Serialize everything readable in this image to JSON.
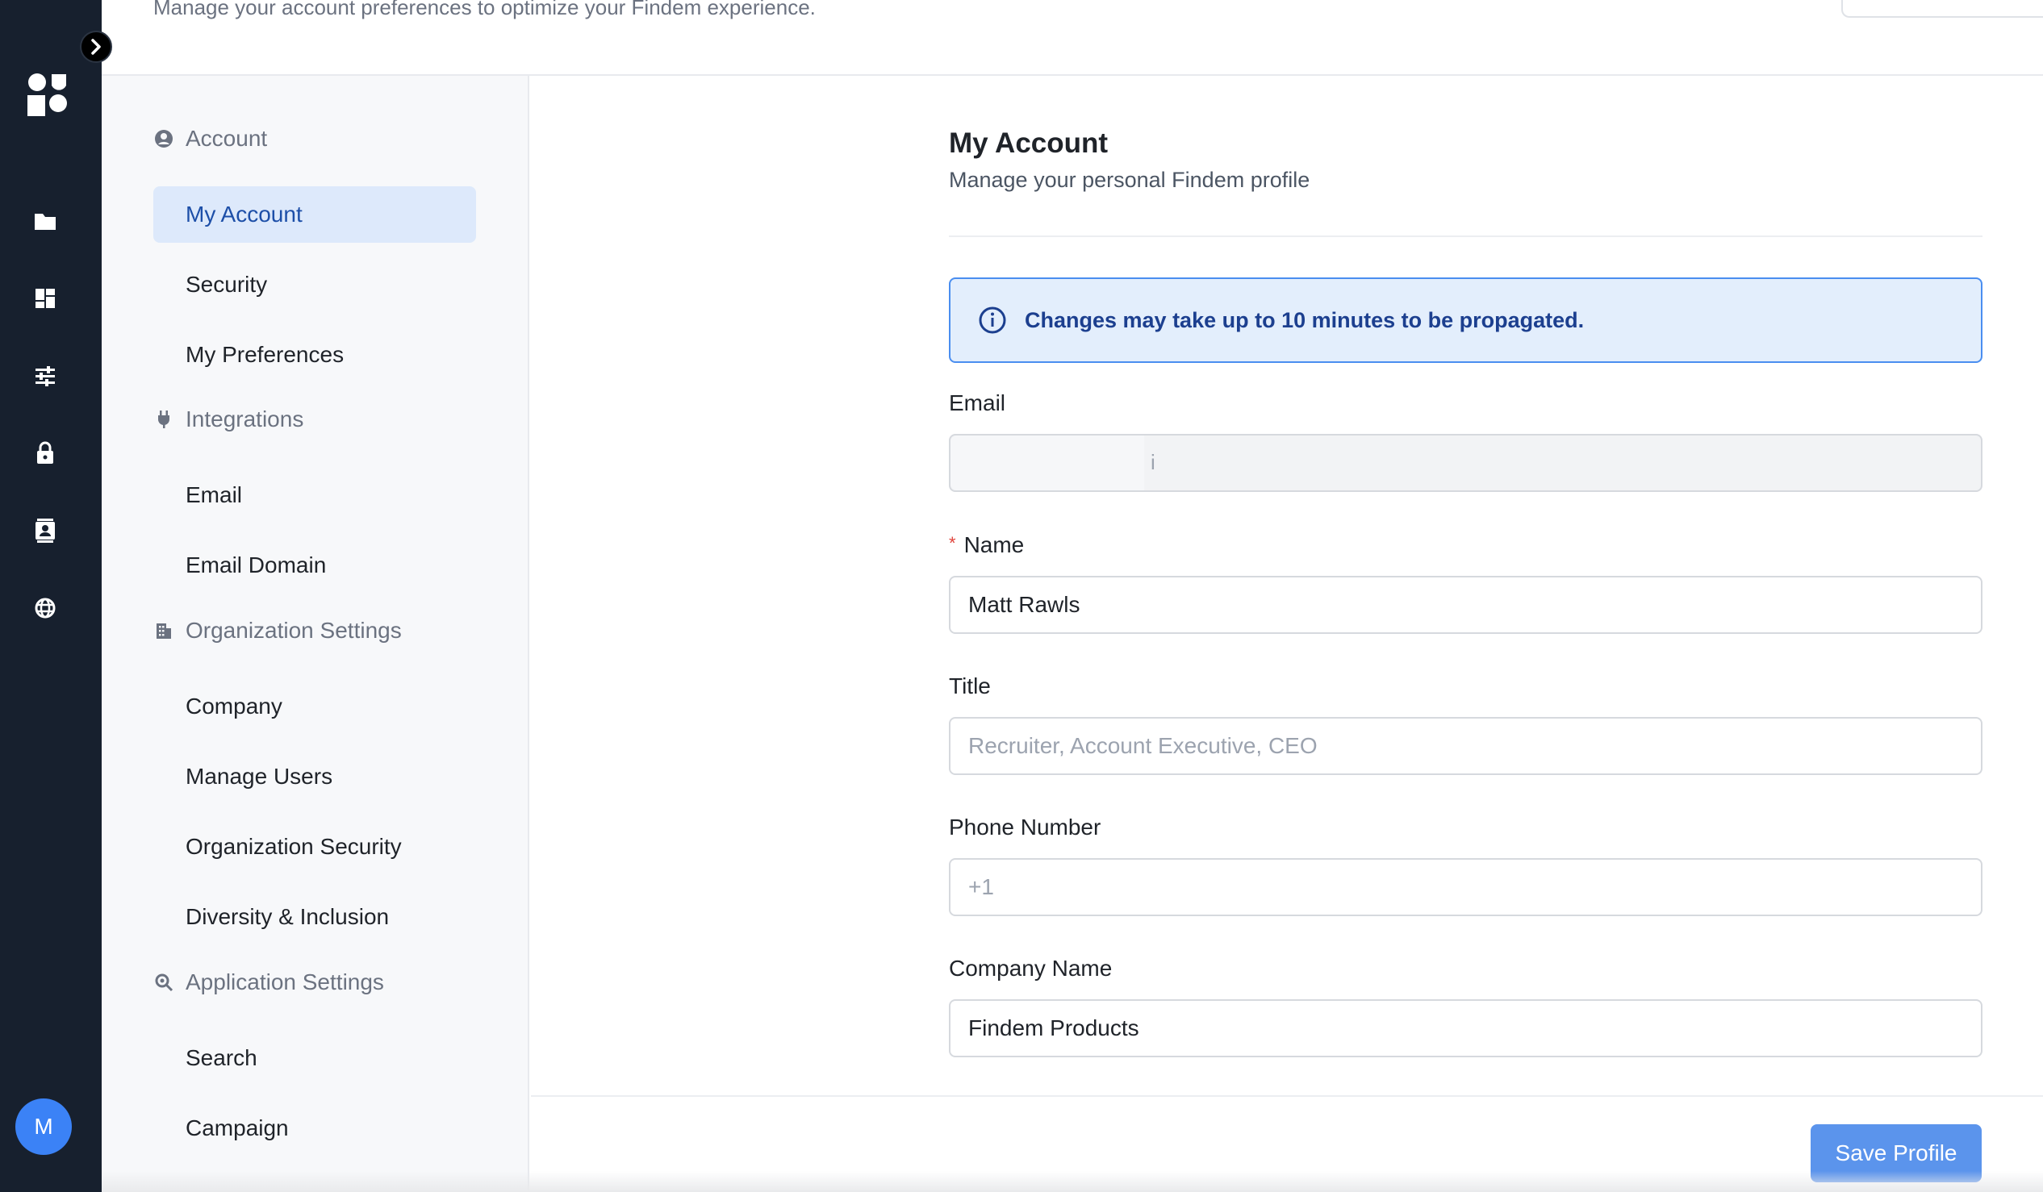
{
  "header": {
    "subtitle": "Manage your account preferences to optimize your Findem experience."
  },
  "rail": {
    "icons": [
      "folder-icon",
      "dashboard-icon",
      "sliders-icon",
      "lock-icon",
      "contact-card-icon",
      "globe-icon"
    ],
    "avatar_initial": "M",
    "avatar_color": "#3b82f6",
    "background": "#17202e"
  },
  "settings_nav": {
    "groups": [
      {
        "label": "Account",
        "icon": "user-circle-icon",
        "items": [
          "My Account",
          "Security",
          "My Preferences"
        ]
      },
      {
        "label": "Integrations",
        "icon": "plug-icon",
        "items": [
          "Email",
          "Email Domain"
        ]
      },
      {
        "label": "Organization Settings",
        "icon": "building-icon",
        "items": [
          "Company",
          "Manage Users",
          "Organization Security",
          "Diversity & Inclusion"
        ]
      },
      {
        "label": "Application Settings",
        "icon": "search-settings-icon",
        "items": [
          "Search",
          "Campaign"
        ]
      }
    ],
    "active_item": "My Account"
  },
  "main": {
    "title": "My Account",
    "subtitle": "Manage your personal Findem profile",
    "notice": "Changes may take up to 10 minutes to be propagated.",
    "fields": {
      "email": {
        "label": "Email",
        "value": "i"
      },
      "name": {
        "label": "Name",
        "required_mark": "*",
        "value": "Matt Rawls"
      },
      "title": {
        "label": "Title",
        "placeholder": "Recruiter, Account Executive, CEO",
        "value": ""
      },
      "phone": {
        "label": "Phone Number",
        "placeholder": "+1",
        "value": ""
      },
      "company": {
        "label": "Company Name",
        "value": "Findem Products"
      }
    },
    "save_label": "Save Profile"
  },
  "colors": {
    "accent": "#5b94ec",
    "active_nav_bg": "#dde9fb",
    "notice_bg": "#e3eefc",
    "notice_border": "#4a8ef0"
  }
}
